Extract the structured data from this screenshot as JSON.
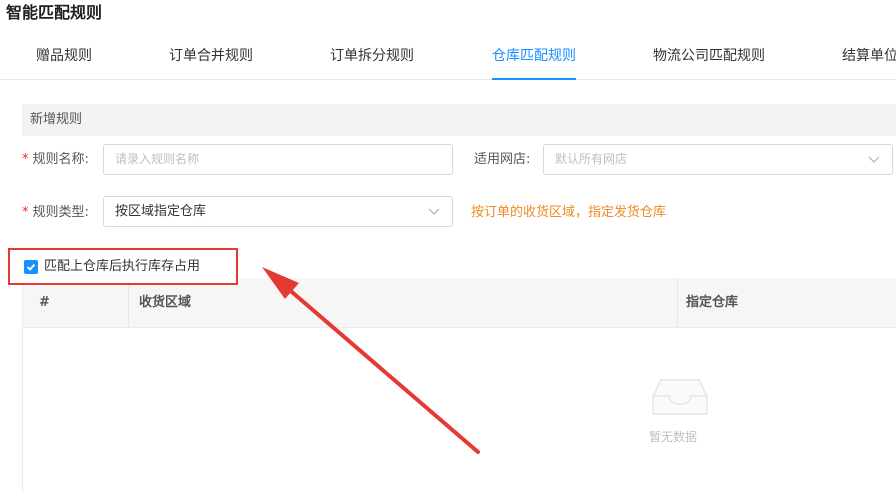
{
  "page": {
    "title": "智能匹配规则"
  },
  "tabs": [
    {
      "label": "赠品规则"
    },
    {
      "label": "订单合并规则"
    },
    {
      "label": "订单拆分规则"
    },
    {
      "label": "仓库匹配规则"
    },
    {
      "label": "物流公司匹配规则"
    },
    {
      "label": "结算单位"
    }
  ],
  "active_tab": "仓库匹配规则",
  "form": {
    "section_title": "新增规则",
    "rule_name": {
      "label": "规则名称:",
      "placeholder": "请录入规则名称",
      "value": ""
    },
    "shop": {
      "label": "适用网店:",
      "placeholder": "默认所有网店"
    },
    "rule_type": {
      "label": "规则类型:",
      "value": "按区域指定仓库"
    },
    "rule_type_hint": "按订单的收货区域，指定发货仓库",
    "occupy_checkbox": {
      "label": "匹配上仓库后执行库存占用",
      "checked": true
    }
  },
  "table": {
    "columns": [
      "#",
      "收货区域",
      "指定仓库"
    ],
    "rows": [],
    "empty_text": "暂无数据"
  },
  "colors": {
    "accent": "#1890ff",
    "annotation_red": "#e53935",
    "hint_orange": "#f08a24",
    "required": "#f5222d"
  }
}
